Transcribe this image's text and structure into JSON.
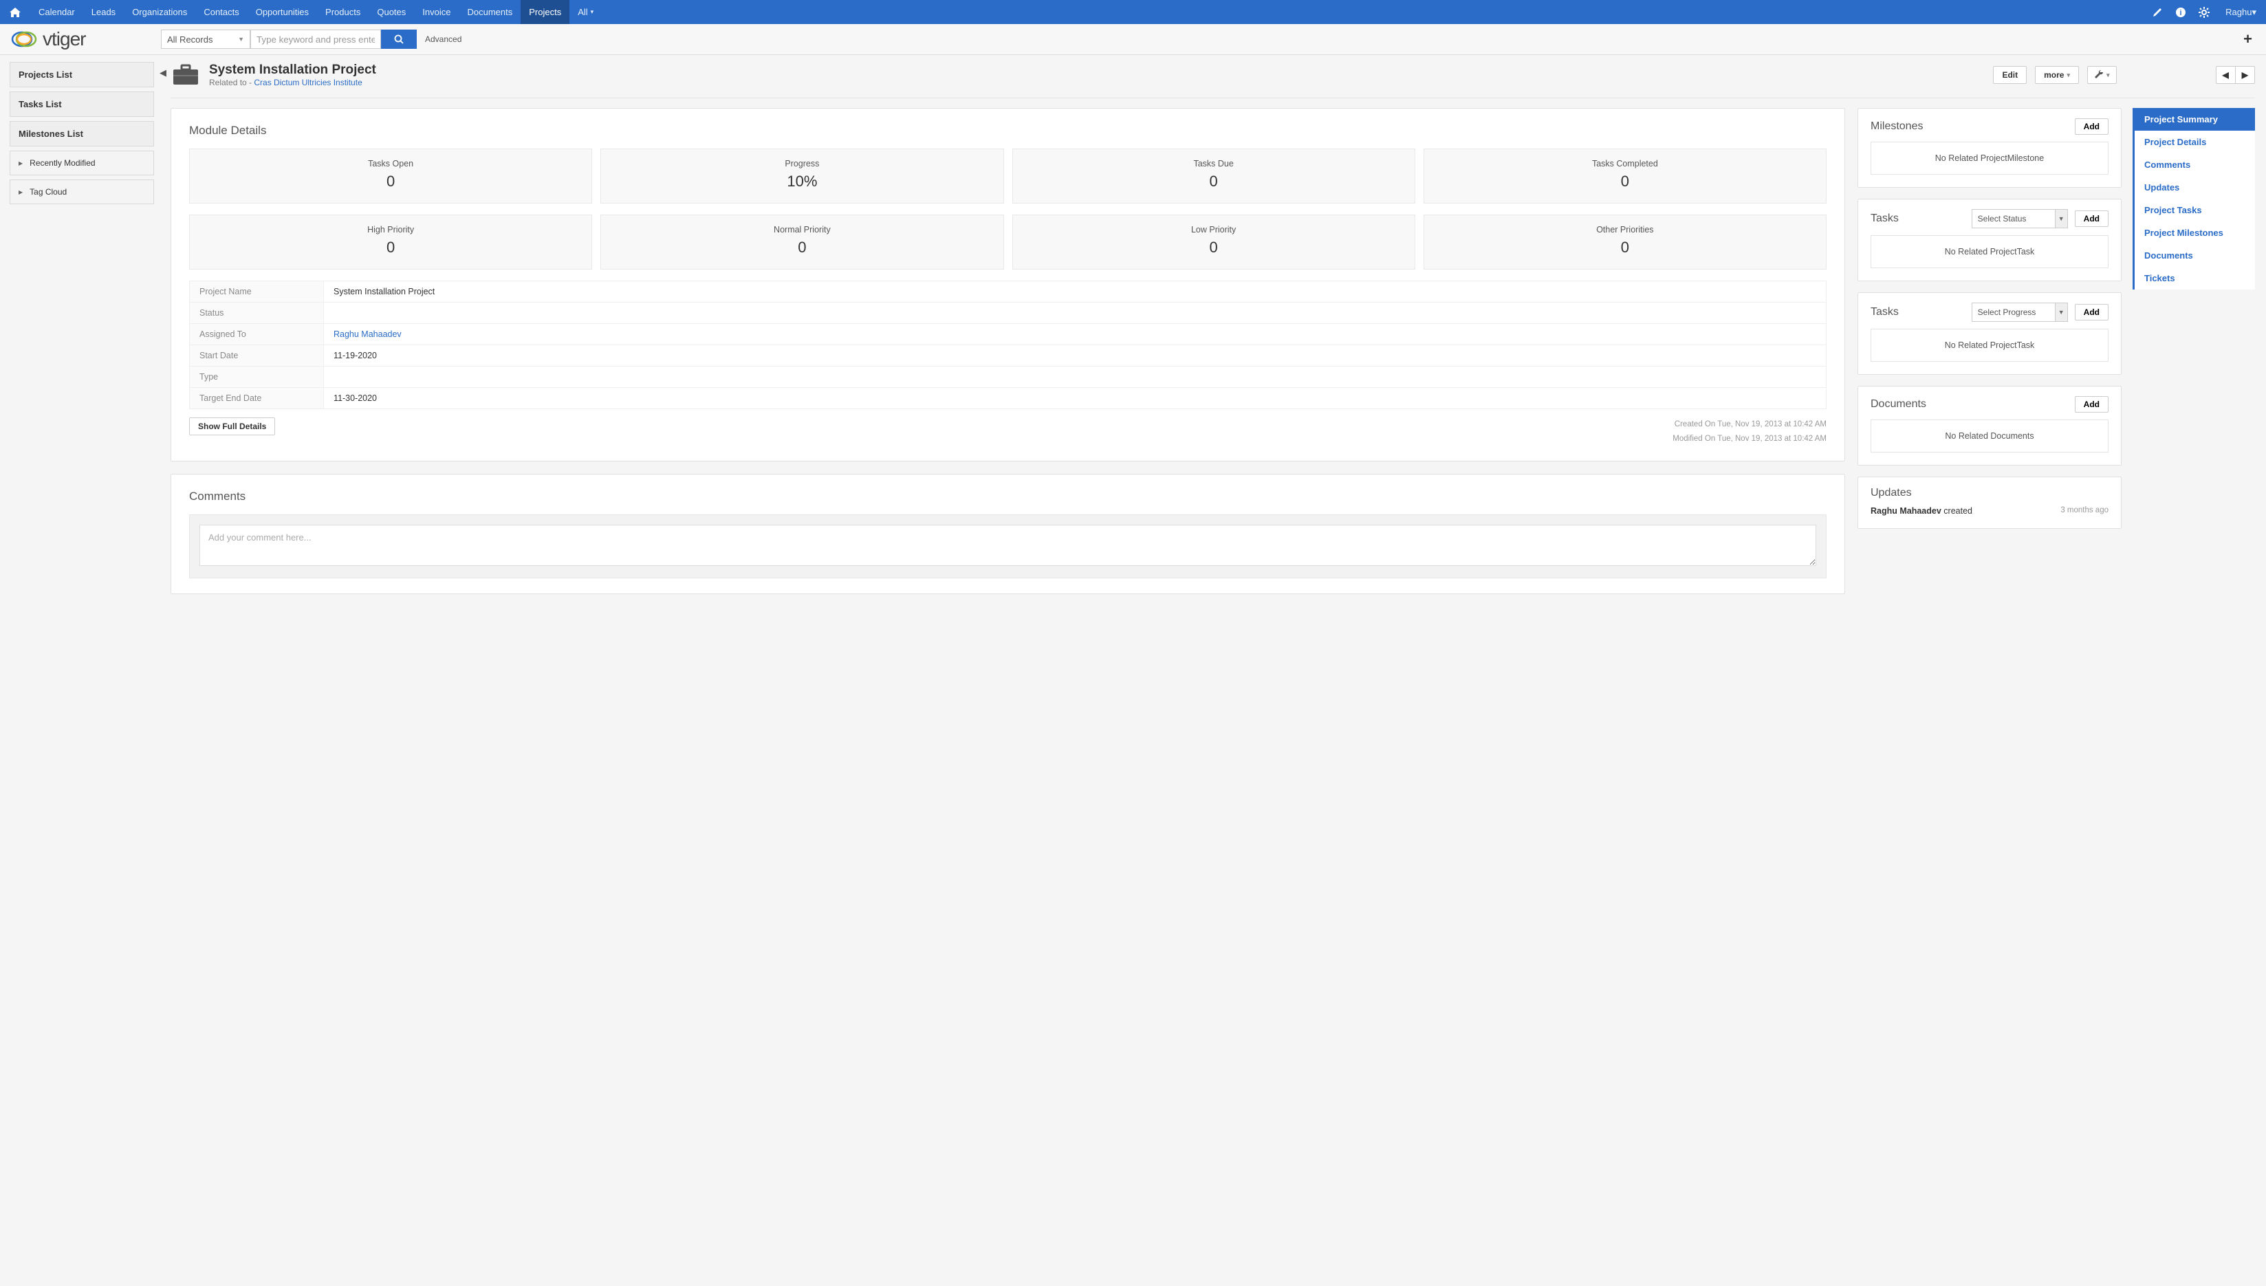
{
  "topnav": {
    "items": [
      "Calendar",
      "Leads",
      "Organizations",
      "Contacts",
      "Opportunities",
      "Products",
      "Quotes",
      "Invoice",
      "Documents",
      "Projects",
      "All"
    ],
    "selected": "Projects",
    "user": "Raghu"
  },
  "secondbar": {
    "records_label": "All Records",
    "search_placeholder": "Type keyword and press enter",
    "advanced": "Advanced",
    "logo_text": "vtiger"
  },
  "left": {
    "items": [
      "Projects List",
      "Tasks List",
      "Milestones List"
    ],
    "sub": [
      "Recently Modified",
      "Tag Cloud"
    ]
  },
  "header": {
    "title": "System Installation Project",
    "related_to_label": "Related to - ",
    "related_to_link": "Cras Dictum Ultricies Institute",
    "edit": "Edit",
    "more": "more"
  },
  "module": {
    "title": "Module Details",
    "stats1": [
      {
        "label": "Tasks Open",
        "val": "0"
      },
      {
        "label": "Progress",
        "val": "10%"
      },
      {
        "label": "Tasks Due",
        "val": "0"
      },
      {
        "label": "Tasks Completed",
        "val": "0"
      }
    ],
    "stats2": [
      {
        "label": "High Priority",
        "val": "0"
      },
      {
        "label": "Normal Priority",
        "val": "0"
      },
      {
        "label": "Low Priority",
        "val": "0"
      },
      {
        "label": "Other Priorities",
        "val": "0"
      }
    ],
    "details": [
      {
        "key": "Project Name",
        "val": "System Installation Project"
      },
      {
        "key": "Status",
        "val": ""
      },
      {
        "key": "Assigned To",
        "val": "Raghu Mahaadev",
        "link": true
      },
      {
        "key": "Start Date",
        "val": "11-19-2020"
      },
      {
        "key": "Type",
        "val": ""
      },
      {
        "key": "Target End Date",
        "val": "11-30-2020"
      }
    ],
    "show_full": "Show Full Details",
    "created": "Created On Tue, Nov 19, 2013 at 10:42 AM",
    "modified": "Modified On Tue, Nov 19, 2013 at 10:42 AM"
  },
  "comments": {
    "title": "Comments",
    "placeholder": "Add your comment here..."
  },
  "right_panels": {
    "milestones": {
      "title": "Milestones",
      "add": "Add",
      "empty": "No Related ProjectMilestone"
    },
    "tasks_status": {
      "title": "Tasks",
      "select": "Select Status",
      "add": "Add",
      "empty": "No Related ProjectTask"
    },
    "tasks_progress": {
      "title": "Tasks",
      "select": "Select Progress",
      "add": "Add",
      "empty": "No Related ProjectTask"
    },
    "documents": {
      "title": "Documents",
      "add": "Add",
      "empty": "No Related Documents"
    },
    "updates": {
      "title": "Updates",
      "line_user": "Raghu Mahaadev",
      "line_action": " created",
      "time": "3 months ago"
    }
  },
  "right_nav": {
    "items": [
      "Project Summary",
      "Project Details",
      "Comments",
      "Updates",
      "Project Tasks",
      "Project Milestones",
      "Documents",
      "Tickets"
    ],
    "selected": "Project Summary"
  }
}
